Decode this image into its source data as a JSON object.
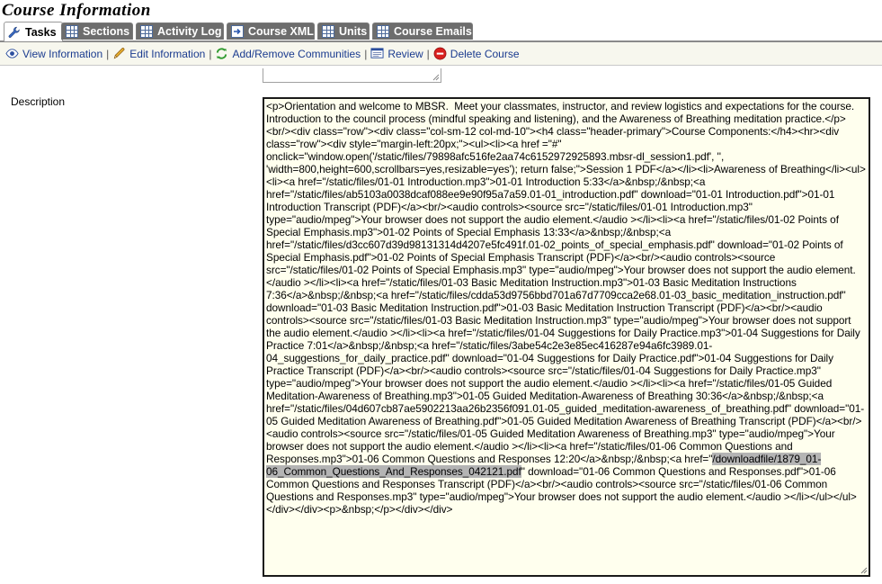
{
  "page": {
    "title": "Course Information"
  },
  "tabs": [
    {
      "label": "Tasks",
      "icon": "wrench-icon",
      "active": true
    },
    {
      "label": "Sections",
      "icon": "grid-icon"
    },
    {
      "label": "Activity Log",
      "icon": "grid-icon"
    },
    {
      "label": "Course XML",
      "icon": "export-icon"
    },
    {
      "label": "Units",
      "icon": "grid-icon"
    },
    {
      "label": "Course Emails",
      "icon": "grid-icon"
    }
  ],
  "actions": [
    {
      "label": "View Information",
      "icon": "eye-icon"
    },
    {
      "label": "Edit Information",
      "icon": "pencil-icon"
    },
    {
      "label": "Add/Remove Communities",
      "icon": "refresh-icon"
    },
    {
      "label": "Review",
      "icon": "review-icon"
    },
    {
      "label": "Delete Course",
      "icon": "delete-icon"
    }
  ],
  "action_separator": "|",
  "description": {
    "label": "Description",
    "text_before": "<p>Orientation and welcome to MBSR.  Meet your classmates, instructor, and review logistics and expectations for the course. Introduction to the council process (mindful speaking and listening), and the Awareness of Breathing meditation practice.</p><br/><div class=\"row\"><div class=\"col-sm-12 col-md-10\"><h4 class=\"header-primary\">Course Components:</h4><hr><div class=\"row\"><div style=\"margin-left:20px;\"><ul><li><a href =\"#\" onclick=\"window.open('/static/files/79898afc516fe2aa74c6152972925893.mbsr-dl_session1.pdf', '', 'width=800,height=600,scrollbars=yes,resizable=yes'); return false;\">Session 1 PDF</a></li><li>Awareness of Breathing</li><ul><li><a href=\"/static/files/01-01 Introduction.mp3\">01-01 Introduction 5:33</a>&nbsp;/&nbsp;<a href=\"/static/files/ab5103a0038dcaf088ee9e90f95a7a59.01-01_introduction.pdf\" download=\"01-01 Introduction.pdf\">01-01 Introduction Transcript (PDF)</a><br/><audio controls><source src=\"/static/files/01-01 Introduction.mp3\" type=\"audio/mpeg\">Your browser does not support the audio element.</audio ></li><li><a href=\"/static/files/01-02 Points of Special Emphasis.mp3\">01-02 Points of Special Emphasis 13:33</a>&nbsp;/&nbsp;<a href=\"/static/files/d3cc607d39d98131314d4207e5fc491f.01-02_points_of_special_emphasis.pdf\" download=\"01-02 Points of Special Emphasis.pdf\">01-02 Points of Special Emphasis Transcript (PDF)</a><br/><audio controls><source src=\"/static/files/01-02 Points of Special Emphasis.mp3\" type=\"audio/mpeg\">Your browser does not support the audio element.</audio ></li><li><a href=\"/static/files/01-03 Basic Meditation Instruction.mp3\">01-03 Basic Meditation Instructions 7:36</a>&nbsp;/&nbsp;<a href=\"/static/files/cdda53d9756bbd701a67d7709cca2e68.01-03_basic_meditation_instruction.pdf\" download=\"01-03 Basic Meditation Instruction.pdf\">01-03 Basic Meditation Instruction Transcript (PDF)</a><br/><audio controls><source src=\"/static/files/01-03 Basic Meditation Instruction.mp3\" type=\"audio/mpeg\">Your browser does not support the audio element.</audio ></li><li><a href=\"/static/files/01-04 Suggestions for Daily Practice.mp3\">01-04 Suggestions for Daily Practice 7:01</a>&nbsp;/&nbsp;<a href=\"/static/files/3abe54c2e3e85ec416287e94a6fc3989.01-04_suggestions_for_daily_practice.pdf\" download=\"01-04 Suggestions for Daily Practice.pdf\">01-04 Suggestions for Daily Practice Transcript (PDF)</a><br/><audio controls><source src=\"/static/files/01-04 Suggestions for Daily Practice.mp3\" type=\"audio/mpeg\">Your browser does not support the audio element.</audio ></li><li><a href=\"/static/files/01-05 Guided Meditation-Awareness of Breathing.mp3\">01-05 Guided Meditation-Awareness of Breathing 30:36</a>&nbsp;/&nbsp;<a href=\"/static/files/04d607cb87ae5902213aa26b2356f091.01-05_guided_meditation-awareness_of_breathing.pdf\" download=\"01-05 Guided Meditation Awareness of Breathing.pdf\">01-05 Guided Meditation Awareness of Breathing Transcript (PDF)</a><br/><audio controls><source src=\"/static/files/01-05 Guided Meditation Awareness of Breathing.mp3\" type=\"audio/mpeg\">Your browser does not support the audio element.</audio ></li><li><a href=\"/static/files/01-06 Common Questions and Responses.mp3\">01-06 Common Questions and Responses 12:20</a>&nbsp;/&nbsp;<a href=\"",
    "text_selected": "/downloadfile/1879_01-06_Common_Questions_And_Responses_042121.pdf",
    "text_after": "\" download=\"01-06 Common Questions and Responses.pdf\">01-06 Common Questions and Responses Transcript (PDF)</a><br/><audio controls><source src=\"/static/files/01-06 Common Questions and Responses.mp3\" type=\"audio/mpeg\">Your browser does not support the audio element.</audio ></li></ul></ul></div></div><p>&nbsp;</p></div></div>"
  },
  "colors": {
    "link": "#1a3b8f",
    "tab_bg": "#6d6d6d",
    "textarea_bg": "#ffffee",
    "actions_bg": "#f7f7ee"
  }
}
